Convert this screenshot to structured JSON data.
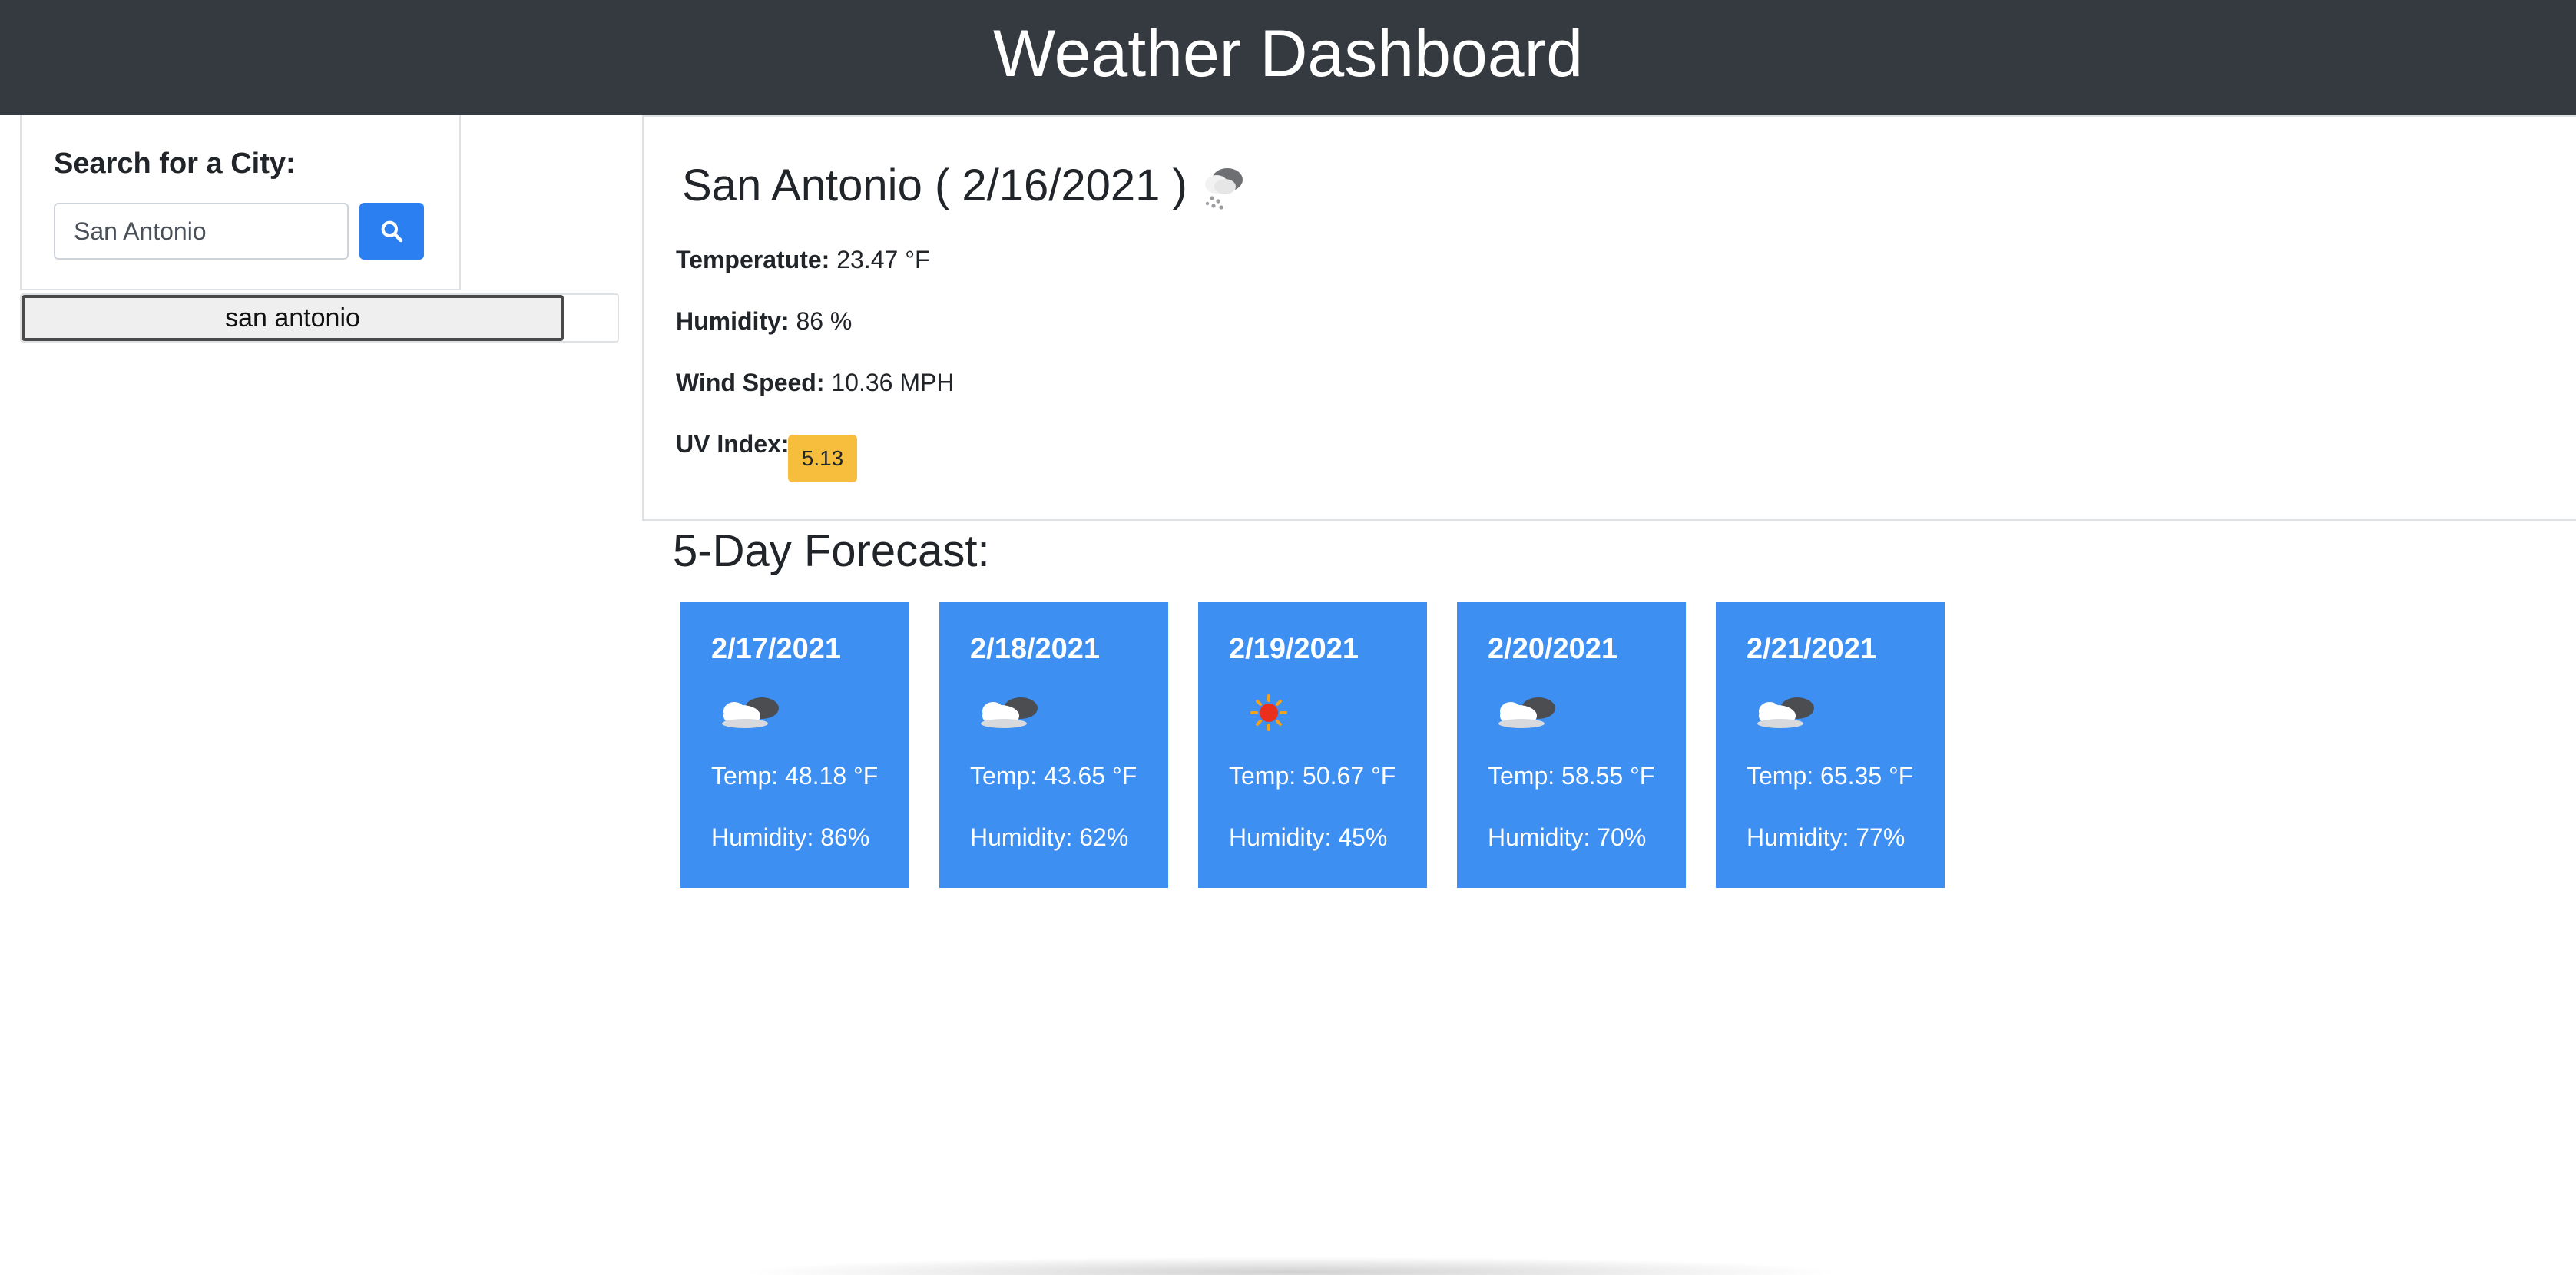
{
  "header": {
    "title": "Weather Dashboard"
  },
  "search": {
    "title": "Search for a City:",
    "value": "San Antonio",
    "button_icon": "search-icon"
  },
  "history": [
    {
      "label": "san antonio"
    }
  ],
  "current": {
    "title": "San Antonio ( 2/16/2021 )",
    "icon": "snow-cloud-icon",
    "temperature_label": "Temperatute:",
    "temperature_value": "23.47 °F",
    "humidity_label": "Humidity:",
    "humidity_value": "86 %",
    "wind_label": "Wind Speed:",
    "wind_value": "10.36 MPH",
    "uv_label": "UV Index:",
    "uv_value": "5.13",
    "uv_color": "#f7bd3c"
  },
  "forecast": {
    "title": "5-Day Forecast:",
    "card_color": "#3d8ff2",
    "days": [
      {
        "date": "2/17/2021",
        "icon": "cloudy-icon",
        "temp": "Temp: 48.18 °F",
        "humidity": "Humidity: 86%"
      },
      {
        "date": "2/18/2021",
        "icon": "cloudy-icon",
        "temp": "Temp: 43.65 °F",
        "humidity": "Humidity: 62%"
      },
      {
        "date": "2/19/2021",
        "icon": "sun-icon",
        "temp": "Temp: 50.67 °F",
        "humidity": "Humidity: 45%"
      },
      {
        "date": "2/20/2021",
        "icon": "cloudy-icon",
        "temp": "Temp: 58.55 °F",
        "humidity": "Humidity: 70%"
      },
      {
        "date": "2/21/2021",
        "icon": "cloudy-icon",
        "temp": "Temp: 65.35 °F",
        "humidity": "Humidity: 77%"
      }
    ]
  }
}
